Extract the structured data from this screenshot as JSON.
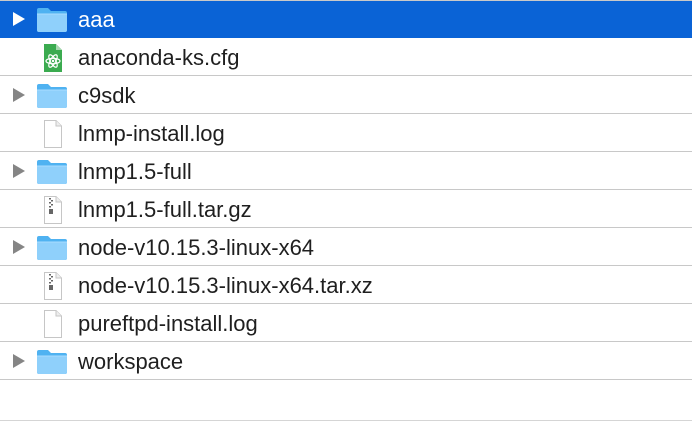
{
  "window": {
    "title": ""
  },
  "files": [
    {
      "name": "aaa",
      "type": "folder",
      "expandable": true,
      "selected": true,
      "icon": "folder-icon"
    },
    {
      "name": "anaconda-ks.cfg",
      "type": "config",
      "expandable": false,
      "selected": false,
      "icon": "atom-file-icon"
    },
    {
      "name": "c9sdk",
      "type": "folder",
      "expandable": true,
      "selected": false,
      "icon": "folder-icon"
    },
    {
      "name": "lnmp-install.log",
      "type": "log",
      "expandable": false,
      "selected": false,
      "icon": "document-icon"
    },
    {
      "name": "lnmp1.5-full",
      "type": "folder",
      "expandable": true,
      "selected": false,
      "icon": "folder-icon"
    },
    {
      "name": "lnmp1.5-full.tar.gz",
      "type": "archive",
      "expandable": false,
      "selected": false,
      "icon": "archive-icon"
    },
    {
      "name": "node-v10.15.3-linux-x64",
      "type": "folder",
      "expandable": true,
      "selected": false,
      "icon": "folder-icon"
    },
    {
      "name": "node-v10.15.3-linux-x64.tar.xz",
      "type": "archive",
      "expandable": false,
      "selected": false,
      "icon": "archive-icon"
    },
    {
      "name": "pureftpd-install.log",
      "type": "log",
      "expandable": false,
      "selected": false,
      "icon": "document-icon"
    },
    {
      "name": "workspace",
      "type": "folder",
      "expandable": true,
      "selected": false,
      "icon": "folder-icon"
    }
  ],
  "colors": {
    "selection": "#0a63d6",
    "folder_light": "#8fd0fb",
    "folder_dark": "#4fb2f1",
    "disclosure": "#858585",
    "text": "#1f1f1f"
  }
}
